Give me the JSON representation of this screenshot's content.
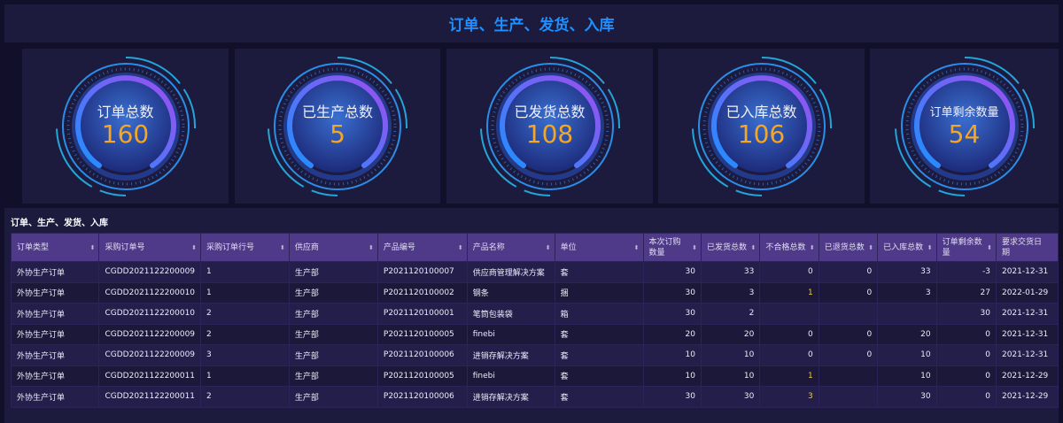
{
  "header": {
    "title": "订单、生产、发货、入库"
  },
  "kpis": [
    {
      "label": "订单总数",
      "value": "160"
    },
    {
      "label": "已生产总数",
      "value": "5"
    },
    {
      "label": "已发货总数",
      "value": "108"
    },
    {
      "label": "已入库总数",
      "value": "106"
    },
    {
      "label": "订单剩余数量",
      "value": "54"
    }
  ],
  "table": {
    "title": "订单、生产、发货、入库",
    "columns": [
      "订单类型",
      "采购订单号",
      "采购订单行号",
      "供应商",
      "产品编号",
      "产品名称",
      "单位",
      "本次订购数量",
      "已发货总数",
      "不合格总数",
      "已退货总数",
      "已入库总数",
      "订单剩余数量",
      "要求交货日期"
    ],
    "rows": [
      [
        "外协生产订单",
        "CGDD2021122200009",
        "1",
        "生产部",
        "P2021120100007",
        "供应商管理解决方案",
        "套",
        "30",
        "33",
        "0",
        "0",
        "33",
        "-3",
        "2021-12-31"
      ],
      [
        "外协生产订单",
        "CGDD2021122200010",
        "1",
        "生产部",
        "P2021120100002",
        "钢条",
        "捆",
        "30",
        "3",
        "1",
        "0",
        "3",
        "27",
        "2022-01-29"
      ],
      [
        "外协生产订单",
        "CGDD2021122200010",
        "2",
        "生产部",
        "P2021120100001",
        "笔筒包装袋",
        "箱",
        "30",
        "2",
        "",
        "",
        "",
        "30",
        "2021-12-31"
      ],
      [
        "外协生产订单",
        "CGDD2021122200009",
        "2",
        "生产部",
        "P2021120100005",
        "finebi",
        "套",
        "20",
        "20",
        "0",
        "0",
        "20",
        "0",
        "2021-12-31"
      ],
      [
        "外协生产订单",
        "CGDD2021122200009",
        "3",
        "生产部",
        "P2021120100006",
        "进销存解决方案",
        "套",
        "10",
        "10",
        "0",
        "0",
        "10",
        "0",
        "2021-12-31"
      ],
      [
        "外协生产订单",
        "CGDD2021122200011",
        "1",
        "生产部",
        "P2021120100005",
        "finebi",
        "套",
        "10",
        "10",
        "1",
        "",
        "10",
        "0",
        "2021-12-29"
      ],
      [
        "外协生产订单",
        "CGDD2021122200011",
        "2",
        "生产部",
        "P2021120100006",
        "进销存解决方案",
        "套",
        "30",
        "30",
        "3",
        "",
        "30",
        "0",
        "2021-12-29"
      ]
    ]
  }
}
